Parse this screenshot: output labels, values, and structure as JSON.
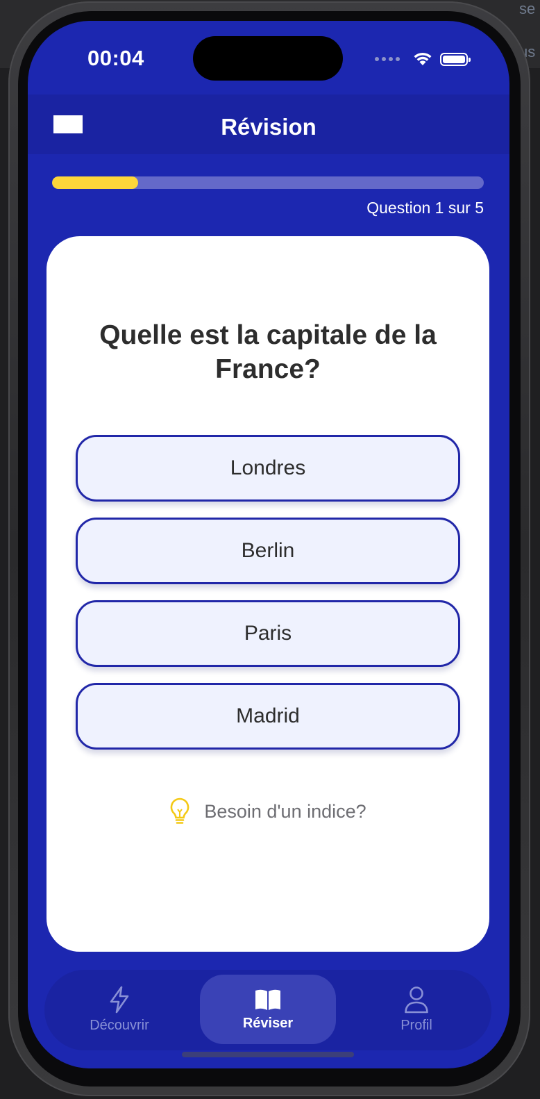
{
  "status_bar": {
    "time": "00:04"
  },
  "header": {
    "title": "Révision"
  },
  "quiz": {
    "progress_fraction": 0.2,
    "progress_text": "Question 1 sur 5",
    "question": "Quelle est la capitale de la France?",
    "options": [
      "Londres",
      "Berlin",
      "Paris",
      "Madrid"
    ],
    "hint_label": "Besoin d'un indice?"
  },
  "tabs": [
    {
      "label": "Découvrir",
      "icon": "lightning-icon",
      "active": false
    },
    {
      "label": "Réviser",
      "icon": "book-icon",
      "active": true
    },
    {
      "label": "Profil",
      "icon": "person-icon",
      "active": false
    }
  ],
  "colors": {
    "background": "#1c27b0",
    "header": "#1a23a2",
    "accent": "#fdd63a",
    "option_border": "#2127a8",
    "option_fill": "#eff2fe"
  },
  "backdrop": {
    "edge_text_top": "se",
    "edge_text_mid": "us"
  }
}
